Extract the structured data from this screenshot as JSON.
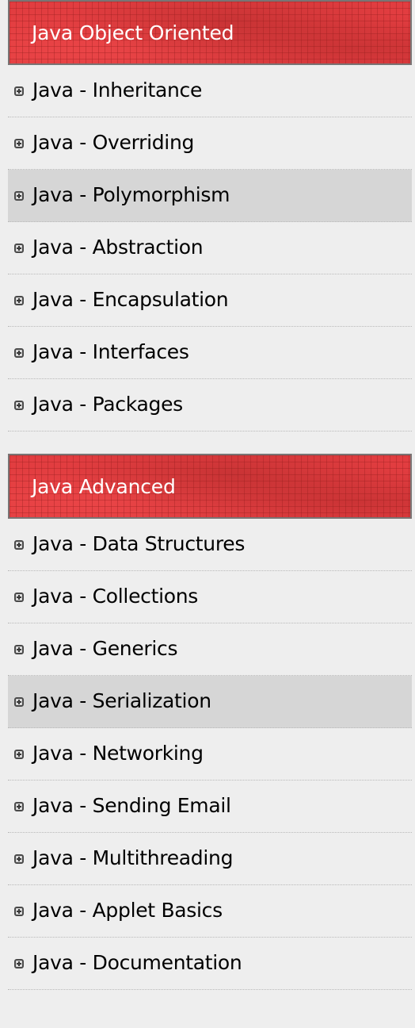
{
  "sections": [
    {
      "title": "Java Object Oriented",
      "items": [
        {
          "label": "Java - Inheritance",
          "highlighted": false
        },
        {
          "label": "Java - Overriding",
          "highlighted": false
        },
        {
          "label": "Java - Polymorphism",
          "highlighted": true
        },
        {
          "label": "Java - Abstraction",
          "highlighted": false
        },
        {
          "label": "Java - Encapsulation",
          "highlighted": false
        },
        {
          "label": "Java - Interfaces",
          "highlighted": false
        },
        {
          "label": "Java - Packages",
          "highlighted": false
        }
      ]
    },
    {
      "title": "Java Advanced",
      "items": [
        {
          "label": "Java - Data Structures",
          "highlighted": false
        },
        {
          "label": "Java - Collections",
          "highlighted": false
        },
        {
          "label": "Java - Generics",
          "highlighted": false
        },
        {
          "label": "Java - Serialization",
          "highlighted": true
        },
        {
          "label": "Java - Networking",
          "highlighted": false
        },
        {
          "label": "Java - Sending Email",
          "highlighted": false
        },
        {
          "label": "Java - Multithreading",
          "highlighted": false
        },
        {
          "label": "Java - Applet Basics",
          "highlighted": false
        },
        {
          "label": "Java - Documentation",
          "highlighted": false
        }
      ]
    }
  ],
  "icons": {
    "item_icon": "plus-square-icon"
  },
  "colors": {
    "header_bg": "#e23d40",
    "header_border": "#7a7474",
    "page_bg": "#eeeeee",
    "highlight_bg": "#d6d6d6",
    "header_text": "#ffffff"
  }
}
